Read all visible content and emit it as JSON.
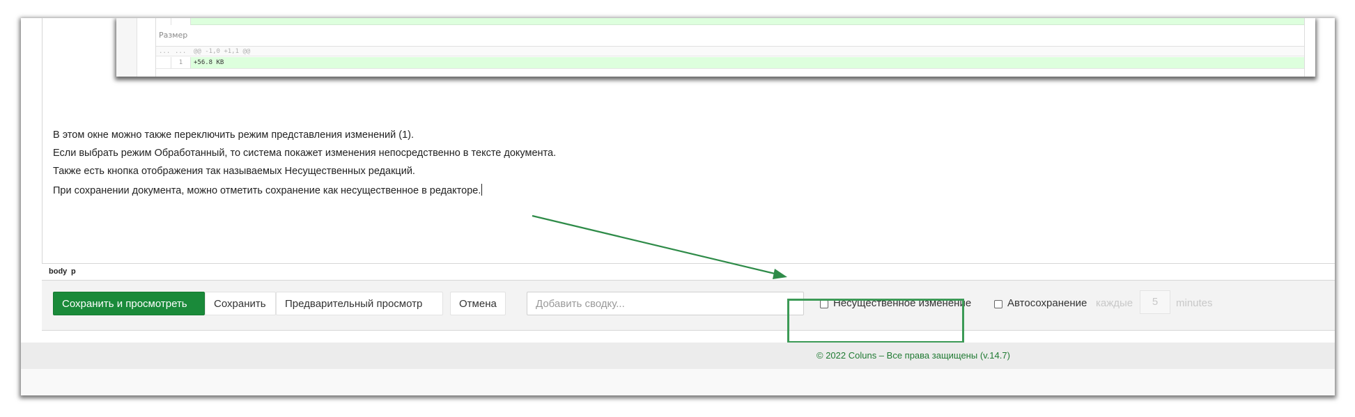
{
  "diff": {
    "section_label": "Размер",
    "hunk_gutter_1": "...",
    "hunk_gutter_2": "...",
    "hunk_header": "@@ -1,0 +1,1 @@",
    "line_number": "1",
    "added_line": "+56.8 KB"
  },
  "content": {
    "paragraphs": [
      "В этом окне можно также переключить режим представления изменений (1).",
      "Если выбрать режим Обработанный, то система покажет изменения непосредственно в тексте документа.",
      "Также есть кнопка отображения так называемых Несущественных редакций.",
      "При сохранении документа, можно отметить сохранение как несущественное в редакторе."
    ]
  },
  "pathbar": {
    "items": [
      "body",
      "p"
    ]
  },
  "toolbar": {
    "save_view_label": "Сохранить и просмотреть",
    "save_label": "Сохранить",
    "preview_label": "Предварительный просмотр",
    "cancel_label": "Отмена",
    "summary_placeholder": "Добавить сводку...",
    "minor_edit_label": "Несущественное изменение",
    "autosave_label": "Автосохранение",
    "every_label": "каждые",
    "interval_value": "5",
    "minutes_label": "minutes"
  },
  "footer": {
    "text": "© 2022 Coluns – Все права защищены (v.14.7)"
  },
  "colors": {
    "accent": "#1a8a3a",
    "highlight": "#3c9a56",
    "diff_add": "#ddffdd"
  }
}
